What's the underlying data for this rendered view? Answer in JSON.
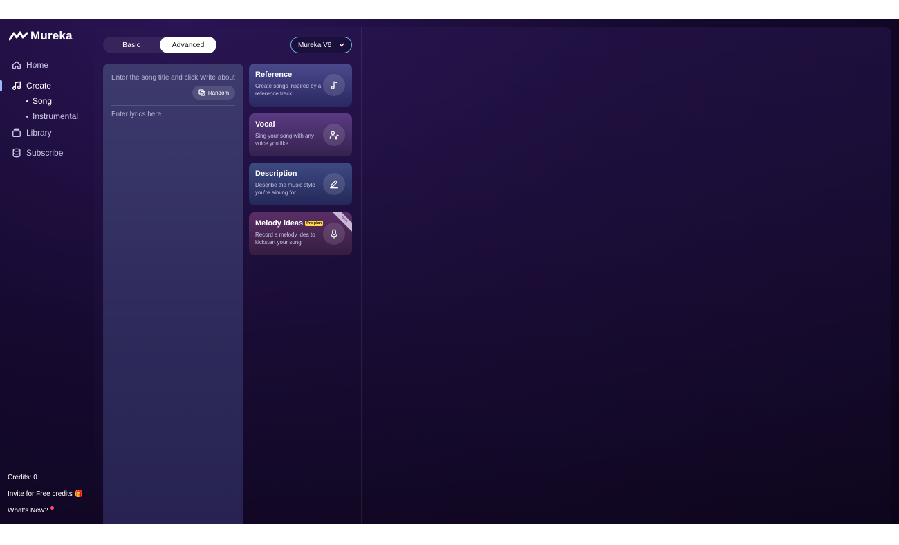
{
  "sidebar": {
    "logo": "Mureka",
    "nav": [
      {
        "label": "Home",
        "icon": "home-icon"
      },
      {
        "label": "Create",
        "icon": "music-note-icon"
      },
      {
        "label": "Library",
        "icon": "library-icon"
      },
      {
        "label": "Subscribe",
        "icon": "database-icon"
      }
    ],
    "create_sub": [
      "Song",
      "Instrumental"
    ],
    "footer": {
      "credits": "Credits: 0",
      "invite": "Invite for Free credits 🎁",
      "whats_new": "What's New?"
    }
  },
  "mode": {
    "basic": "Basic",
    "advanced": "Advanced",
    "selected": "Advanced"
  },
  "model": {
    "value": "Mureka V6"
  },
  "editor": {
    "title_placeholder": "Enter the song title and click Write about",
    "random_label": "Random",
    "lyrics_placeholder": "Enter lyrics here"
  },
  "cards": [
    {
      "title": "Reference",
      "desc": "Create songs inspired by a reference track",
      "icon": "music-note-icon"
    },
    {
      "title": "Vocal",
      "desc": "Sing your song with any voice you like",
      "icon": "person-music-icon"
    },
    {
      "title": "Description",
      "desc": "Describe the music style you're aiming for",
      "icon": "pencil-icon"
    },
    {
      "title": "Melody ideas",
      "desc": "Record a melody idea to kickstart your song",
      "icon": "microphone-icon",
      "badge": "Pro plan",
      "ribbon": "Beta"
    }
  ],
  "colors": {
    "accent": "#9fb4ff",
    "pro_badge": "#ffd84a",
    "notification_dot": "#ff4d6a"
  }
}
